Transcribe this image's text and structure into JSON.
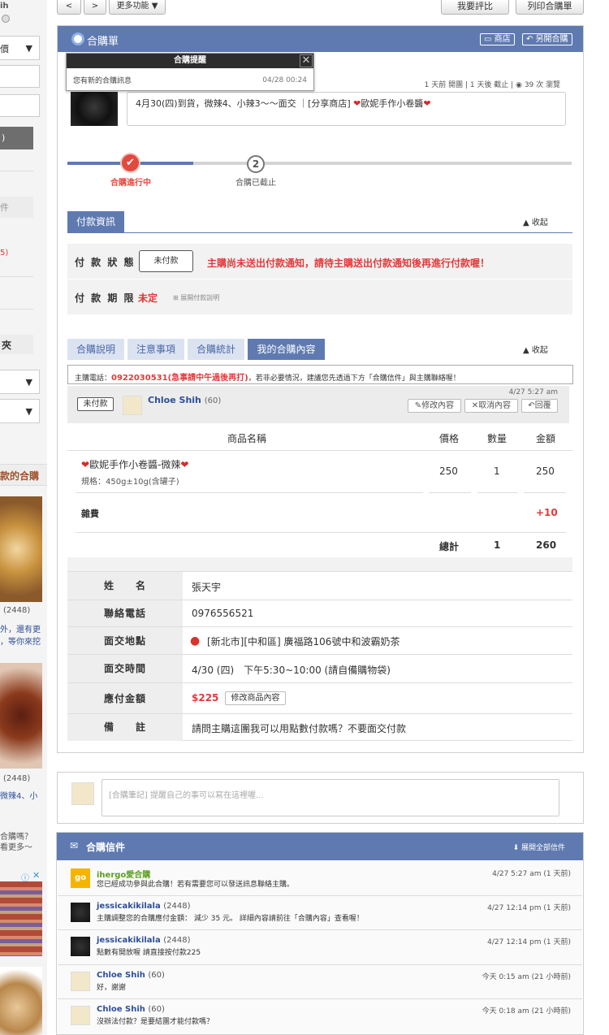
{
  "topnav": {
    "prev": "<",
    "next": ">",
    "more": "更多功能",
    "compare": "我要評比",
    "print": "列印合購單"
  },
  "sidebar": {
    "frag_top": "ih",
    "sel1": "價",
    "frag_menu": ")",
    "frag_file": "件",
    "frag_num": "5)",
    "folder": "夾",
    "group_title": "款的合購",
    "item1_count": "(2448)",
    "item1_text1": "外，還有更",
    "item1_text2": "，等你來挖",
    "item2_count": "(2448)",
    "item2_text": "微辣4、小",
    "promo1": "合購嗎？",
    "promo2": "看更多～"
  },
  "panel": {
    "title": "合購單",
    "btn_shop": "商店",
    "btn_newopen": "另開合購"
  },
  "popup": {
    "title": "合購提醒",
    "message": "您有新的合購訊息",
    "time": "04/28 00:24",
    "close": "✕"
  },
  "meta": {
    "opened": "1 天前 開團",
    "deadline": "1 天後 截止",
    "views": "39 次 瀏覽"
  },
  "description": {
    "text": "4月30(四)到貨，微辣4、小辣3～～面交 ｜[分享商店]",
    "shop": "歐妮手作小卷醬"
  },
  "progress": {
    "step1_label": "合購進行中",
    "step2_label": "合購已截止",
    "step2_num": "2"
  },
  "payment": {
    "tab": "付款資訊",
    "collapse": "收起",
    "status_label": "付 款 狀 態 ：",
    "status_btn": "未付款",
    "status_warning": "主購尚未送出付款通知，請待主購送出付款通知後再進行付款喔！",
    "deadline_label": "付 款 期 限 ：",
    "deadline_value": "未定",
    "deadline_link": "展開付款說明"
  },
  "tabs": {
    "t1": "合購說明",
    "t2": "注意事項",
    "t3": "合購統計",
    "t4": "我的合購內容",
    "collapse": "收起"
  },
  "phone": {
    "prefix": "主購電話：",
    "number": "0922030531(急事請中午過後再打)",
    "suffix": "，若非必要情況，建議您先透過下方「合購信件」與主購聯絡喔！"
  },
  "order": {
    "status": "未付款",
    "user": "Chloe Shih",
    "user_count": "(60)",
    "time": "4/27 5:27 am",
    "btn_edit": "修改內容",
    "btn_cancel": "取消內容",
    "btn_reply": "回覆",
    "col_name": "商品名稱",
    "col_price": "價格",
    "col_qty": "數量",
    "col_amount": "金額",
    "item_name": "歐妮手作小卷醬-微辣",
    "item_spec": "規格：450g±10g(含罐子)",
    "item_price": "250",
    "item_qty": "1",
    "item_amount": "250",
    "misc_label": "雜費",
    "misc_amount": "+10",
    "total_label": "總計",
    "total_qty": "1",
    "total_amount": "260"
  },
  "buyer": {
    "name_label": "姓　　名",
    "name": "張天宇",
    "phone_label": "聯絡電話",
    "phone": "0976556521",
    "place_label": "面交地點",
    "place": "[新北市][中和區] 廣福路106號中和波霸奶茶",
    "time_label": "面交時間",
    "time": "4/30 (四)　下午5:30~10:00 (請自備購物袋)",
    "pay_label": "應付金額",
    "pay": "$225",
    "pay_btn": "修改商品內容",
    "note_label": "備　　註",
    "note": "請問主購這團我可以用點數付款嗎？不要面交付款"
  },
  "note": {
    "placeholder": "[合購筆記] 提醒自己的事可以寫在這裡喔..."
  },
  "mail": {
    "title": "合購信件",
    "expand": "展開全部信件",
    "items": [
      {
        "name": "ihergo愛合購",
        "count": "",
        "msg": "您已經成功參與此合購！若有需要您可以發送訊息聯絡主購。",
        "time": "4/27 5:27 am (1 天前)"
      },
      {
        "name": "jessicakikilala",
        "count": "(2448)",
        "msg": "主購調整您的合購應付金額： 減少 35 元。 詳細內容請前往「合購內容」查看喔！",
        "time": "4/27 12:14 pm (1 天前)"
      },
      {
        "name": "jessicakikilala",
        "count": "(2448)",
        "msg": "點數有開放喔 請直接按付款225",
        "time": "4/27 12:14 pm (1 天前)"
      },
      {
        "name": "Chloe Shih",
        "count": "(60)",
        "msg": "好，謝謝",
        "time": "今天 0:15 am (21 小時前)"
      },
      {
        "name": "Chloe Shih",
        "count": "(60)",
        "msg": "沒辦法付款？是要結團才能付款嗎？",
        "time": "今天 0:18 am (21 小時前)"
      }
    ]
  },
  "colors": {
    "brand": "#5f7ab1",
    "warn": "#e23a3a",
    "tab_light": "#dbe3f1"
  }
}
